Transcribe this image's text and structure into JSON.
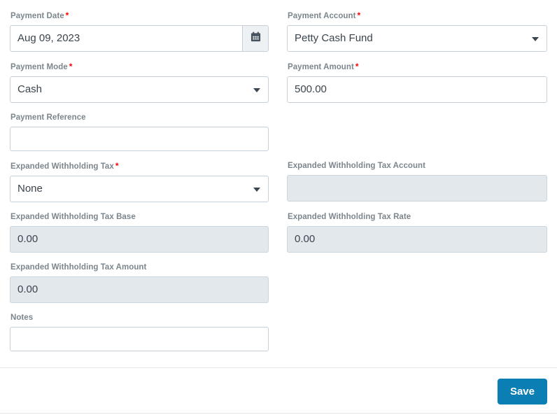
{
  "form": {
    "rows": [
      {
        "left": {
          "label": "Payment Date",
          "required": "*",
          "value": "Aug 09, 2023",
          "type": "date",
          "icon": "calendar-icon",
          "name": "payment-date"
        },
        "right": {
          "label": "Payment Account",
          "required": "*",
          "value": "Petty Cash Fund",
          "type": "select",
          "name": "payment-account"
        }
      },
      {
        "left": {
          "label": "Payment Mode",
          "required": "*",
          "value": "Cash",
          "type": "select",
          "name": "payment-mode"
        },
        "right": {
          "label": "Payment Amount",
          "required": "*",
          "value": "500.00",
          "type": "text",
          "name": "payment-amount"
        }
      },
      {
        "left": {
          "label": "Payment Reference",
          "required": "",
          "value": "",
          "type": "text-short",
          "name": "payment-reference"
        },
        "right": null
      },
      {
        "left": {
          "label": "Expanded Withholding Tax",
          "required": "*",
          "value": "None",
          "type": "select",
          "name": "expanded-withholding-tax"
        },
        "right": {
          "label": "Expanded Withholding Tax Account",
          "required": "",
          "value": "",
          "type": "text-disabled",
          "name": "expanded-withholding-tax-account"
        }
      },
      {
        "left": {
          "label": "Expanded Withholding Tax Base",
          "required": "",
          "value": "0.00",
          "type": "text-disabled",
          "name": "expanded-withholding-tax-base"
        },
        "right": {
          "label": "Expanded Withholding Tax Rate",
          "required": "",
          "value": "0.00",
          "type": "text-disabled",
          "name": "expanded-withholding-tax-rate"
        }
      },
      {
        "left": {
          "label": "Expanded Withholding Tax Amount",
          "required": "",
          "value": "0.00",
          "type": "text-disabled",
          "name": "expanded-withholding-tax-amount"
        },
        "right": null
      },
      {
        "left": {
          "label": "Notes",
          "required": "",
          "value": "",
          "type": "text-short",
          "name": "notes"
        },
        "right": null
      }
    ]
  },
  "footer": {
    "save_label": "Save"
  },
  "colors": {
    "accent": "#0b7fb4",
    "required": "#ff0000",
    "label": "#7c868d",
    "border": "#c7d0d8",
    "disabled_bg": "#e3e8ed",
    "text": "#3a444d"
  }
}
